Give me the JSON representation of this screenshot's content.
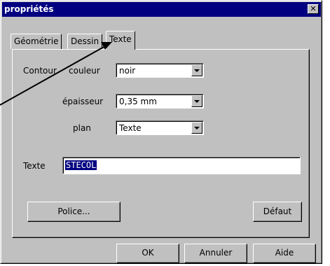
{
  "window": {
    "title": "propriétés",
    "close_glyph": "✕"
  },
  "tabs": [
    {
      "label": "Géométrie"
    },
    {
      "label": "Dessin"
    },
    {
      "label": "Texte",
      "active": true
    }
  ],
  "contour": {
    "group_label": "Contour",
    "couleur_label": "couleur",
    "couleur_value": "noir",
    "epaisseur_label": "épaisseur",
    "epaisseur_value": "0,35 mm",
    "plan_label": "plan",
    "plan_value": "Texte"
  },
  "texte": {
    "label": "Texte",
    "value": "STECOL"
  },
  "buttons": {
    "police": "Police...",
    "defaut": "Défaut",
    "ok": "OK",
    "annuler": "Annuler",
    "aide": "Aide"
  },
  "colors": {
    "titlebar": "#000080",
    "dialog_face": "#c0c0c0",
    "selection": "#000080"
  },
  "icons": [
    "close-icon",
    "chevron-down-icon",
    "annotation-arrow"
  ]
}
